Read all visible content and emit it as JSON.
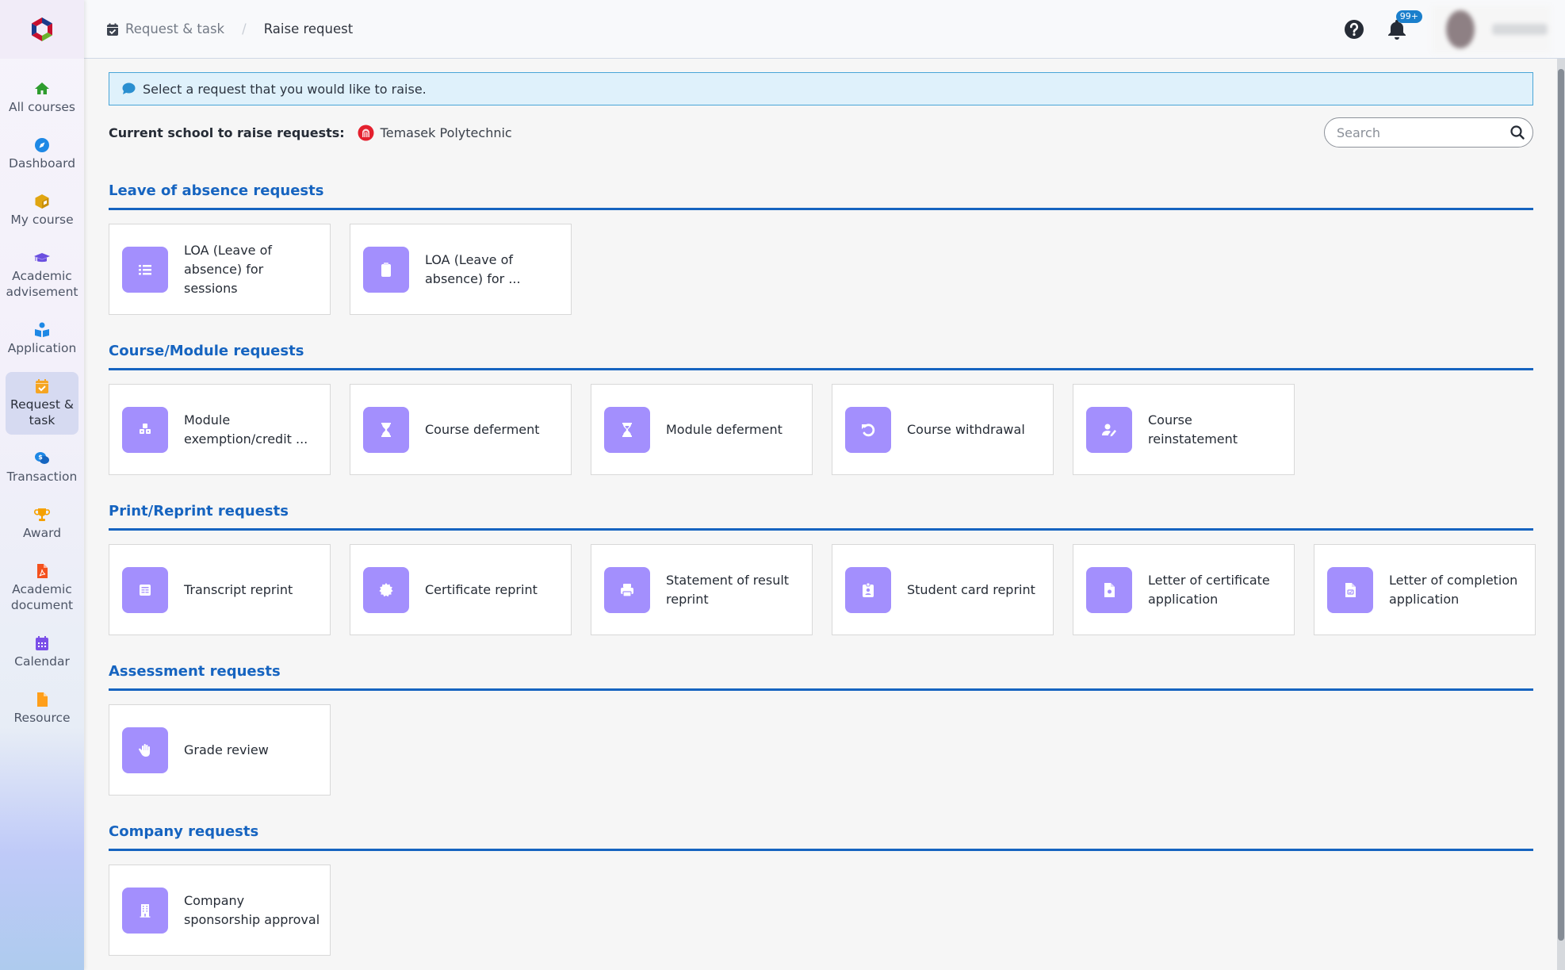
{
  "app": {
    "logo": "shutter-logo"
  },
  "sidebar": {
    "items": [
      {
        "label": "All courses",
        "icon": "home-icon",
        "color": "#2e9c2e",
        "active": false
      },
      {
        "label": "Dashboard",
        "icon": "compass-icon",
        "color": "#1e88e5",
        "active": false
      },
      {
        "label": "My course",
        "icon": "box-icon",
        "color": "#e0a511",
        "active": false
      },
      {
        "label": "Academic advisement",
        "icon": "graduation-cap-icon",
        "color": "#6a4fe0",
        "active": false
      },
      {
        "label": "Application",
        "icon": "reader-icon",
        "color": "#1e88e5",
        "active": false
      },
      {
        "label": "Request & task",
        "icon": "calendar-check-icon",
        "color": "#f5a523",
        "active": true
      },
      {
        "label": "Transaction",
        "icon": "dollar-chat-icon",
        "color": "#1e88e5",
        "active": false
      },
      {
        "label": "Award",
        "icon": "trophy-icon",
        "color": "#f5a000",
        "active": false
      },
      {
        "label": "Academic document",
        "icon": "pdf-file-icon",
        "color": "#f4511e",
        "active": false
      },
      {
        "label": "Calendar",
        "icon": "calendar-icon",
        "color": "#7a4fe8",
        "active": false
      },
      {
        "label": "Resource",
        "icon": "file-icon",
        "color": "#ff9f1a",
        "active": false
      }
    ]
  },
  "header": {
    "breadcrumb": {
      "parent": "Request & task",
      "separator": "/",
      "current": "Raise request"
    },
    "notification_badge": "99+"
  },
  "main": {
    "info_banner": "Select a request that you would like to raise.",
    "school_label": "Current school to raise requests:",
    "school_name": "Temasek Polytechnic",
    "search_placeholder": "Search",
    "search_value": "",
    "sections": [
      {
        "title": "Leave of absence requests",
        "cards": [
          {
            "label": "LOA (Leave of absence) for sessions",
            "icon": "list-icon"
          },
          {
            "label": "LOA (Leave of absence) for ...",
            "icon": "clipboard-icon"
          }
        ]
      },
      {
        "title": "Course/Module requests",
        "cards": [
          {
            "label": "Module exemption/credit ...",
            "icon": "cubes-icon"
          },
          {
            "label": "Course deferment",
            "icon": "hourglass-icon"
          },
          {
            "label": "Module deferment",
            "icon": "hourglass-half-icon"
          },
          {
            "label": "Course withdrawal",
            "icon": "undo-icon"
          },
          {
            "label": "Course reinstatement",
            "icon": "user-edit-icon"
          }
        ]
      },
      {
        "title": "Print/Reprint requests",
        "cards": [
          {
            "label": "Transcript reprint",
            "icon": "document-list-icon"
          },
          {
            "label": "Certificate reprint",
            "icon": "certificate-icon"
          },
          {
            "label": "Statement of result reprint",
            "icon": "print-icon"
          },
          {
            "label": "Student card reprint",
            "icon": "id-badge-icon"
          },
          {
            "label": "Letter of certificate application",
            "icon": "file-badge-icon"
          },
          {
            "label": "Letter of completion application",
            "icon": "file-check-icon"
          }
        ]
      },
      {
        "title": "Assessment requests",
        "cards": [
          {
            "label": "Grade review",
            "icon": "hand-icon"
          }
        ]
      },
      {
        "title": "Company requests",
        "cards": [
          {
            "label": "Company sponsorship approval",
            "icon": "building-icon"
          }
        ]
      }
    ]
  },
  "colors": {
    "accent": "#1664c0",
    "card_icon_bg": "#a38ffd",
    "banner_bg": "#dff1fb",
    "banner_border": "#49a5d7",
    "badge": "#1b7fcc"
  }
}
